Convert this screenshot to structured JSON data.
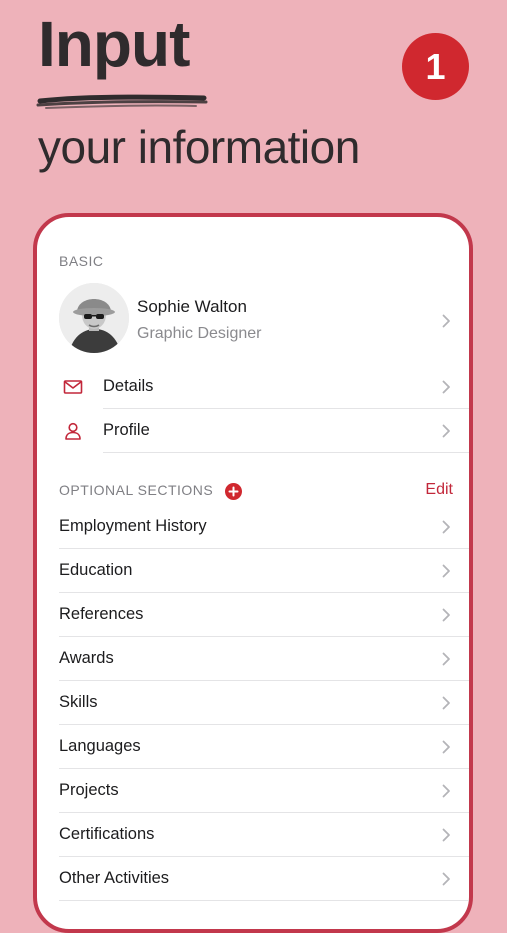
{
  "promo": {
    "headline_line1": "Input",
    "headline_line2": "your information",
    "step_number": "1"
  },
  "colors": {
    "background": "#eeb2ba",
    "accent": "#d0282f",
    "frame": "#c2384c"
  },
  "basic": {
    "section_label": "BASIC",
    "profile": {
      "name": "Sophie Walton",
      "role": "Graphic Designer"
    },
    "items": [
      {
        "label": "Details",
        "icon": "envelope-icon"
      },
      {
        "label": "Profile",
        "icon": "person-icon"
      }
    ]
  },
  "optional": {
    "section_label": "OPTIONAL SECTIONS",
    "edit_label": "Edit",
    "items": [
      {
        "label": "Employment History"
      },
      {
        "label": "Education"
      },
      {
        "label": "References"
      },
      {
        "label": "Awards"
      },
      {
        "label": "Skills"
      },
      {
        "label": "Languages"
      },
      {
        "label": "Projects"
      },
      {
        "label": "Certifications"
      },
      {
        "label": "Other Activities"
      }
    ]
  }
}
